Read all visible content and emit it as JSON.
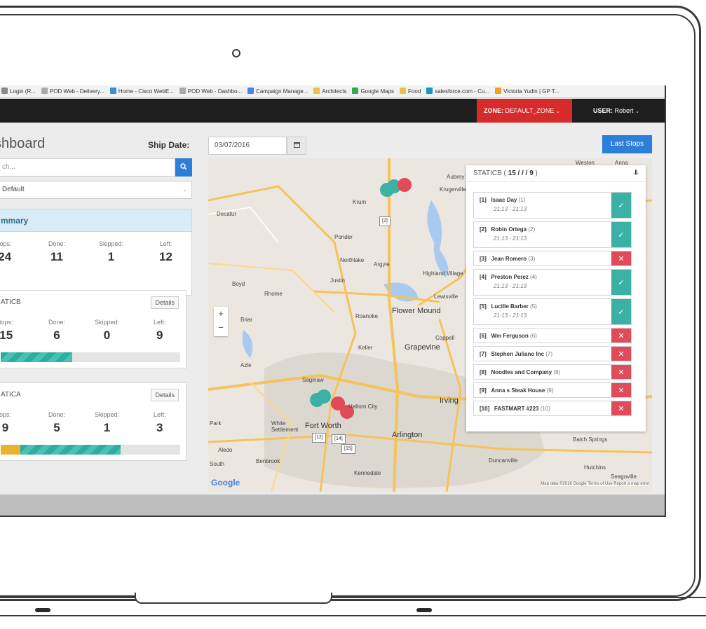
{
  "bookmarks": [
    {
      "label": "Login (R...",
      "color": "#888888"
    },
    {
      "label": "POD Web - Delivery...",
      "color": "#aaaaaa"
    },
    {
      "label": "Home - Cisco WebE...",
      "color": "#3a8fd1"
    },
    {
      "label": "POD Web - Dashbo...",
      "color": "#aaaaaa"
    },
    {
      "label": "Campaign Manage...",
      "color": "#4285f4"
    },
    {
      "label": "Architects",
      "color": "#e7c34a"
    },
    {
      "label": "Google Maps",
      "color": "#34a853"
    },
    {
      "label": "Food",
      "color": "#e7c34a"
    },
    {
      "label": "salesforce.com - Cu...",
      "color": "#1798c1"
    },
    {
      "label": "Victoria Yudin | GP T...",
      "color": "#f0a020"
    }
  ],
  "nav": {
    "zone_label": "ZONE:",
    "zone_value": "DEFAULT_ZONE",
    "user_label": "USER:",
    "user_value": "Robert"
  },
  "header": {
    "title": "shboard",
    "ship_date_label": "Ship Date:",
    "ship_date_value": "03/07/2016",
    "last_stops_label": "Last Stops"
  },
  "filters": {
    "search_placeholder": "ch...",
    "select_value": "Default"
  },
  "summary": {
    "title": "mmary",
    "stats": [
      {
        "label": "tops:",
        "value": "24"
      },
      {
        "label": "Done:",
        "value": "11"
      },
      {
        "label": "Skipped:",
        "value": "1"
      },
      {
        "label": "Left:",
        "value": "12"
      }
    ]
  },
  "routes": [
    {
      "name": "ATICB",
      "details_label": "Details",
      "stats": [
        {
          "label": "tops:",
          "value": "15"
        },
        {
          "label": "Done:",
          "value": "6"
        },
        {
          "label": "Skipped:",
          "value": "0"
        },
        {
          "label": "Left:",
          "value": "9"
        }
      ],
      "progress_done_fraction": 0.4,
      "progress_skipped_fraction": 0
    },
    {
      "name": "ATICA",
      "details_label": "Details",
      "stats": [
        {
          "label": "ops:",
          "value": "9"
        },
        {
          "label": "Done:",
          "value": "5"
        },
        {
          "label": "Skipped:",
          "value": "1"
        },
        {
          "label": "Left:",
          "value": "3"
        }
      ],
      "progress_done_fraction": 0.556,
      "progress_skipped_fraction": 0.111
    }
  ],
  "map": {
    "google_logo": "Google",
    "credit": "Map data ©2016 Google   Terms of Use   Report a map error",
    "zoom_in": "+",
    "zoom_out": "−",
    "places": [
      "Decatur",
      "Krum",
      "Aubrey",
      "Krugerville",
      "Ponder",
      "Northlake",
      "Argyle",
      "Justin",
      "Boyd",
      "Rhome",
      "Lewisville",
      "Briar",
      "Roanoke",
      "Flower Mound",
      "Highland Village",
      "Keller",
      "Grapevine",
      "Coppell",
      "Azle",
      "Saginaw",
      "White Settlement",
      "Park",
      "Aledo",
      "Benbrook",
      "Kennedale",
      "Arlington",
      "Duncanville",
      "Balch Springs",
      "Hutchins",
      "Seagoville",
      "Irving",
      "Fort Worth",
      "Haltom City",
      "South",
      "Weston",
      "Anna"
    ],
    "marker_tags": [
      "[2]",
      "[12]",
      "[14]",
      "[15]"
    ]
  },
  "stop_panel": {
    "route_name": "STATICB",
    "counts": "15 / / / 9",
    "stops": [
      {
        "idx": "[1]",
        "name": "Isaac Day",
        "num": "(1)",
        "time": "21:13 - 21:13",
        "status": "done"
      },
      {
        "idx": "[2]",
        "name": "Robin Ortega",
        "num": "(2)",
        "time": "21:13 - 21:13",
        "status": "done"
      },
      {
        "idx": "[3]",
        "name": "Jean Romero",
        "num": "(3)",
        "time": "",
        "status": "fail"
      },
      {
        "idx": "[4]",
        "name": "Preston Perez",
        "num": "(4)",
        "time": "21:13 - 21:13",
        "status": "done"
      },
      {
        "idx": "[5]",
        "name": "Lucille Barber",
        "num": "(5)",
        "time": "21:13 - 21:13",
        "status": "done"
      },
      {
        "idx": "[6]",
        "name": "Wm Ferguson",
        "num": "(6)",
        "time": "",
        "status": "fail"
      },
      {
        "idx": "[7]",
        "name": "Stephen Juliano Inc",
        "num": "(7)",
        "time": "",
        "status": "fail"
      },
      {
        "idx": "[8]",
        "name": "Noodles and Company",
        "num": "(8)",
        "time": "",
        "status": "fail"
      },
      {
        "idx": "[9]",
        "name": "Anna s Steak House",
        "num": "(9)",
        "time": "",
        "status": "fail"
      },
      {
        "idx": "[10]",
        "name": "FASTMART #223",
        "num": "(10)",
        "time": "",
        "status": "fail"
      }
    ]
  },
  "colors": {
    "accent_blue": "#2c7fd9",
    "zone_red": "#d62b2b",
    "done_teal": "#3bb0a4",
    "fail_red": "#e04b5a",
    "skipped_yellow": "#e8b32d"
  }
}
